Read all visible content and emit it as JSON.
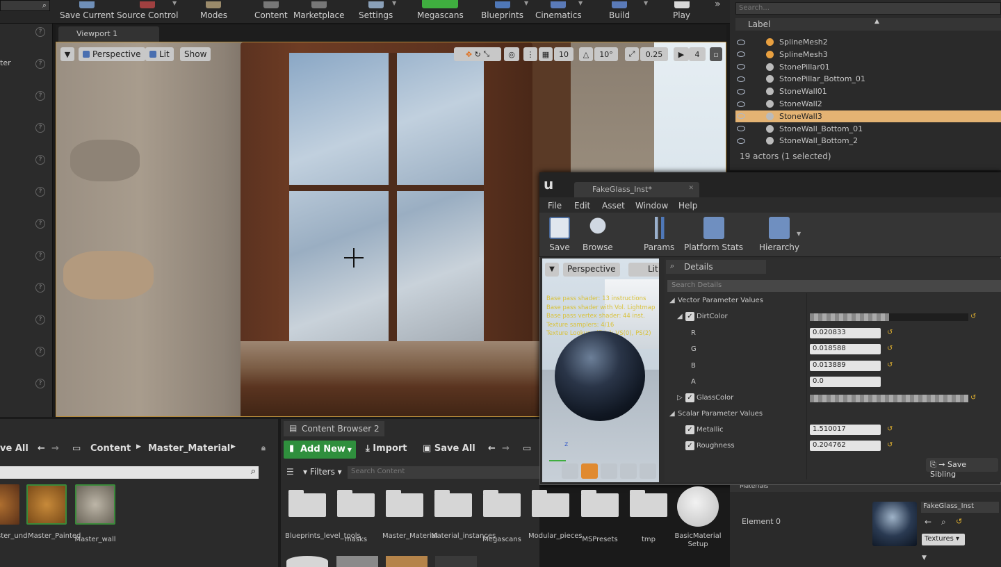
{
  "toolbar": {
    "save_current": "Save Current",
    "source_control": "Source Control",
    "modes": "Modes",
    "content": "Content",
    "marketplace": "Marketplace",
    "settings": "Settings",
    "megascans": "Megascans",
    "blueprints": "Blueprints",
    "cinematics": "Cinematics",
    "build": "Build",
    "play": "Play",
    "overflow": "»"
  },
  "left_panel": {
    "partial_label": "ter"
  },
  "viewport": {
    "tab": "Viewport 1",
    "perspective": "Perspective",
    "lit": "Lit",
    "show": "Show",
    "grid_snap": "10",
    "rot_snap": "10°",
    "scale_snap": "0.25",
    "cam_speed": "4"
  },
  "outliner": {
    "search_placeholder": "Search...",
    "label_header": "Label",
    "items": [
      "SplineMesh2",
      "SplineMesh3",
      "StonePillar01",
      "StonePillar_Bottom_01",
      "StoneWall01",
      "StoneWall2",
      "StoneWall3",
      "StoneWall_Bottom_01",
      "StoneWall_Bottom_2"
    ],
    "selected_index": 6,
    "count": "19 actors (1 selected)"
  },
  "material_editor": {
    "tab": "FakeGlass_Inst*",
    "menu": [
      "File",
      "Edit",
      "Asset",
      "Window",
      "Help"
    ],
    "tools": {
      "save": "Save",
      "browse": "Browse",
      "params": "Params",
      "platform_stats": "Platform Stats",
      "hierarchy": "Hierarchy"
    },
    "preview": {
      "perspective": "Perspective",
      "lit": "Lit",
      "stats": [
        "Base pass shader: 13 instructions",
        "Base pass shader with Vol. Lightmap",
        "Base pass vertex shader: 44 inst.",
        "Texture samplers: 4/16",
        "Texture Lookups (Est.): VS(0), PS(2)"
      ]
    },
    "details": {
      "tab": "Details",
      "search_placeholder": "Search Details",
      "vector_header": "Vector Parameter Values",
      "dirt_color": "DirtColor",
      "r_label": "R",
      "r": "0.020833",
      "g_label": "G",
      "g": "0.018588",
      "b_label": "B",
      "b": "0.013889",
      "a_label": "A",
      "a": "0.0",
      "glass_color": "GlassColor",
      "scalar_header": "Scalar Parameter Values",
      "metallic": "Metallic",
      "metallic_value": "1.510017",
      "roughness": "Roughness",
      "roughness_value": "0.204762",
      "save_sibling": "Save Sibling"
    }
  },
  "content_browser_left": {
    "save_all": "ve All",
    "content": "Content",
    "master_material": "Master_Material",
    "thumbs": [
      "ster_und",
      "Master_Painted",
      "Master_wall"
    ]
  },
  "content_browser_right": {
    "tab": "Content Browser 2",
    "add_new": "Add New",
    "import": "Import",
    "save_all": "Save All",
    "filters": "Filters",
    "search_placeholder": "Search Content",
    "folders": [
      "Blueprints_level_tools",
      "masks",
      "Master_Material",
      "Material_instances",
      "Megascans",
      "Modular_pieces",
      "MSPresets",
      "tmp"
    ],
    "basic": "BasicMaterial Setup"
  },
  "element_panel": {
    "partial_header": "Materials",
    "element": "Element 0",
    "asset": "FakeGlass_Inst",
    "textures": "Textures"
  }
}
